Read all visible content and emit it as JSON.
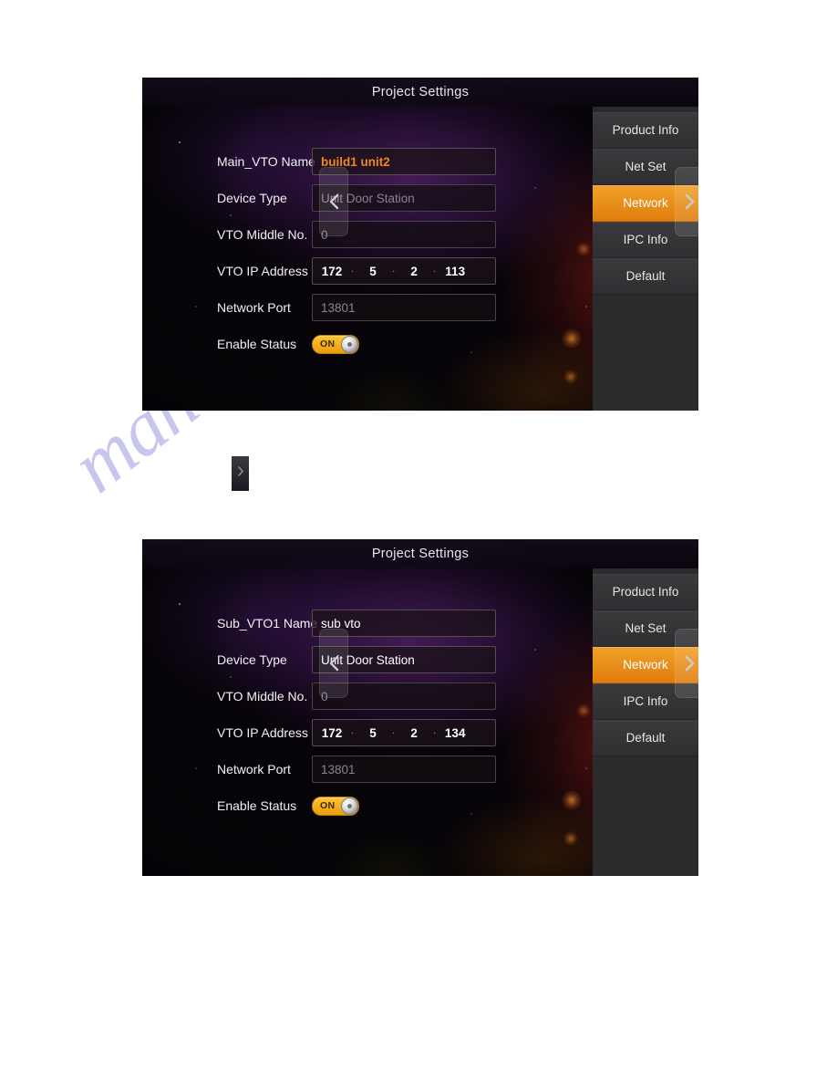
{
  "page": {
    "watermark": "manualsarchive.com"
  },
  "mini_button": {
    "icon": "chevron-right-icon"
  },
  "panels": [
    {
      "id": "panel-1",
      "title": "Project Settings",
      "nav": {
        "prev_icon": "chevron-left-icon",
        "next_icon": "chevron-right-icon"
      },
      "menu": {
        "items": [
          {
            "label": "Product Info",
            "active": false
          },
          {
            "label": "Net Set",
            "active": false
          },
          {
            "label": "Network",
            "active": true
          },
          {
            "label": "IPC Info",
            "active": false
          },
          {
            "label": "Default",
            "active": false
          }
        ],
        "active_color": "#e88a12"
      },
      "fields": {
        "vto_name": {
          "label": "Main_VTO Name",
          "value": "build1 unit2",
          "state": "accent"
        },
        "device_type": {
          "label": "Device Type",
          "value": "Unit Door Station",
          "state": "disabled"
        },
        "vto_middle_no": {
          "label": "VTO Middle No.",
          "value": "0",
          "state": "disabled"
        },
        "vto_ip": {
          "label": "VTO IP Address",
          "octets": [
            "172",
            "5",
            "2",
            "113"
          ],
          "separator": "."
        },
        "network_port": {
          "label": "Network Port",
          "value": "13801",
          "state": "disabled"
        },
        "enable_status": {
          "label": "Enable Status",
          "value": "ON"
        }
      }
    },
    {
      "id": "panel-2",
      "title": "Project Settings",
      "nav": {
        "prev_icon": "chevron-left-icon",
        "next_icon": "chevron-right-icon"
      },
      "menu": {
        "items": [
          {
            "label": "Product Info",
            "active": false
          },
          {
            "label": "Net Set",
            "active": false
          },
          {
            "label": "Network",
            "active": true
          },
          {
            "label": "IPC Info",
            "active": false
          },
          {
            "label": "Default",
            "active": false
          }
        ],
        "active_color": "#e88a12"
      },
      "fields": {
        "vto_name": {
          "label": "Sub_VTO1 Name",
          "value": "sub vto",
          "state": "normal"
        },
        "device_type": {
          "label": "Device Type",
          "value": "Unit Door Station",
          "state": "normal"
        },
        "vto_middle_no": {
          "label": "VTO Middle No.",
          "value": "0",
          "state": "disabled"
        },
        "vto_ip": {
          "label": "VTO IP Address",
          "octets": [
            "172",
            "5",
            "2",
            "134"
          ],
          "separator": "."
        },
        "network_port": {
          "label": "Network Port",
          "value": "13801",
          "state": "disabled"
        },
        "enable_status": {
          "label": "Enable Status",
          "value": "ON"
        }
      }
    }
  ]
}
